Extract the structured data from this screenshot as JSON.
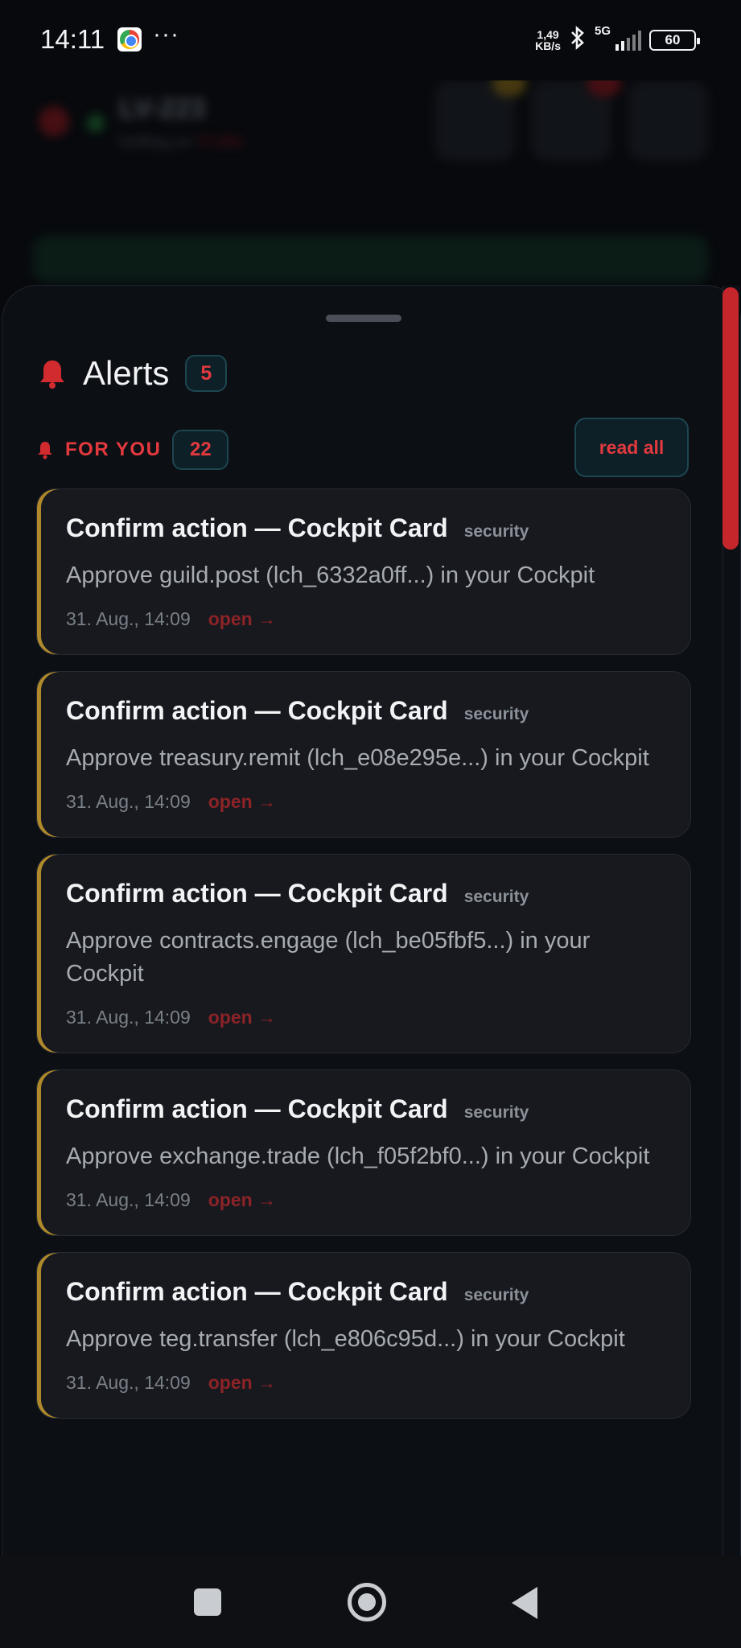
{
  "status_bar": {
    "time": "14:11",
    "dots": "···",
    "net_speed_value": "1,49",
    "net_speed_unit": "KB/s",
    "network": "5G",
    "battery": "60"
  },
  "backdrop": {
    "title": "LV-223",
    "subtitle": "Drifting on",
    "subtitle_accent": "77.5%"
  },
  "sheet": {
    "title": "Alerts",
    "count": "5",
    "section_label": "FOR YOU",
    "section_count": "22",
    "read_all_label": "read all"
  },
  "alerts": [
    {
      "title": "Confirm action — Cockpit Card",
      "tag": "security",
      "body": "Approve guild.post (lch_6332a0ff...) in your Cockpit",
      "time": "31. Aug., 14:09",
      "open_label": "open →"
    },
    {
      "title": "Confirm action — Cockpit Card",
      "tag": "security",
      "body": "Approve treasury.remit (lch_e08e295e...) in your Cockpit",
      "time": "31. Aug., 14:09",
      "open_label": "open →"
    },
    {
      "title": "Confirm action — Cockpit Card",
      "tag": "security",
      "body": "Approve contracts.engage (lch_be05fbf5...) in your Cockpit",
      "time": "31. Aug., 14:09",
      "open_label": "open →"
    },
    {
      "title": "Confirm action — Cockpit Card",
      "tag": "security",
      "body": "Approve exchange.trade (lch_f05f2bf0...) in your Cockpit",
      "time": "31. Aug., 14:09",
      "open_label": "open →"
    },
    {
      "title": "Confirm action — Cockpit Card",
      "tag": "security",
      "body": "Approve teg.transfer (lch_e806c95d...) in your Cockpit",
      "time": "31. Aug., 14:09",
      "open_label": "open →"
    }
  ],
  "colors": {
    "accent_red": "#e2393e",
    "card_border_accent": "#b08a2a",
    "badge_bg": "#0d2027",
    "sheet_bg": "#0c0f14"
  },
  "icons": {
    "header": "bell-icon",
    "section": "bell-icon",
    "nav": [
      "recents-icon",
      "home-icon",
      "back-icon"
    ]
  }
}
